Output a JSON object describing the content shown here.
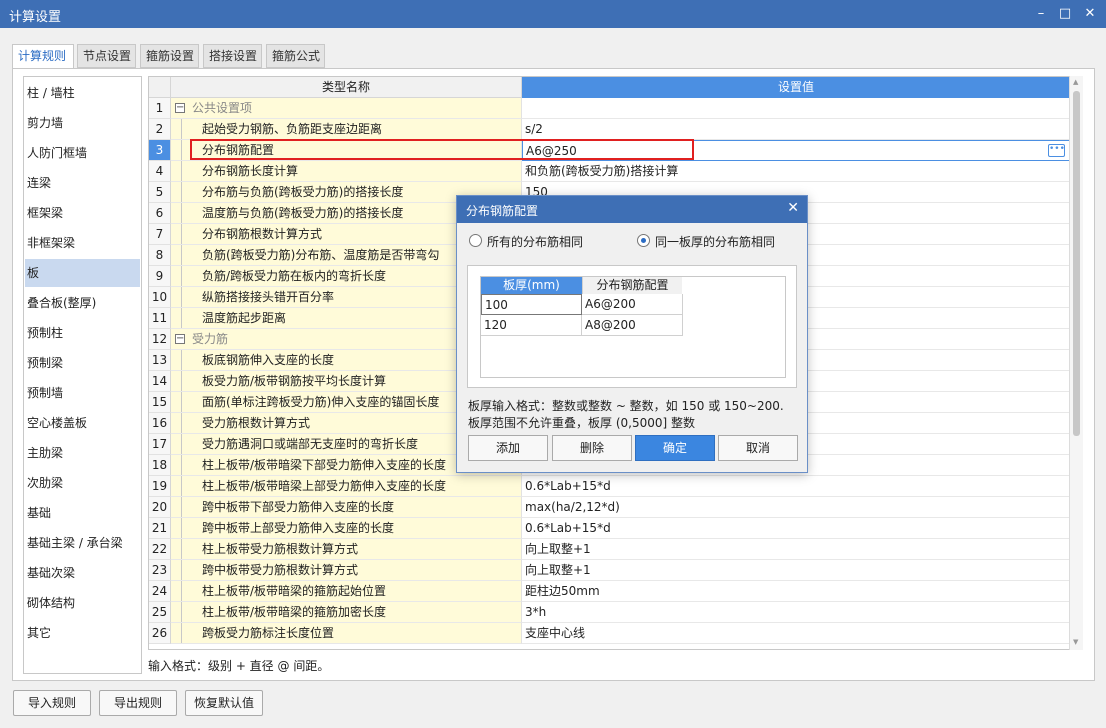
{
  "window": {
    "title": "计算设置",
    "min": "–",
    "max": "□",
    "close": "✕"
  },
  "tabs": [
    "计算规则",
    "节点设置",
    "箍筋设置",
    "搭接设置",
    "箍筋公式"
  ],
  "sidebar": [
    "柱 / 墙柱",
    "剪力墙",
    "人防门框墙",
    "连梁",
    "框架梁",
    "非框架梁",
    "板",
    "叠合板(整厚)",
    "预制柱",
    "预制梁",
    "预制墙",
    "空心楼盖板",
    "主肋梁",
    "次肋梁",
    "基础",
    "基础主梁 / 承台梁",
    "基础次梁",
    "砌体结构",
    "其它"
  ],
  "grid": {
    "headers": {
      "name": "类型名称",
      "value": "设置值"
    },
    "rows": [
      {
        "num": "1",
        "name": "公共设置项",
        "value": ""
      },
      {
        "num": "2",
        "name": "起始受力钢筋、负筋距支座边距离",
        "value": "s/2"
      },
      {
        "num": "3",
        "name": "分布钢筋配置",
        "value": "A6@250"
      },
      {
        "num": "4",
        "name": "分布钢筋长度计算",
        "value": "和负筋(跨板受力筋)搭接计算"
      },
      {
        "num": "5",
        "name": "分布筋与负筋(跨板受力筋)的搭接长度",
        "value": "150"
      },
      {
        "num": "6",
        "name": "温度筋与负筋(跨板受力筋)的搭接长度",
        "value": ""
      },
      {
        "num": "7",
        "name": "分布钢筋根数计算方式",
        "value": ""
      },
      {
        "num": "8",
        "name": "负筋(跨板受力筋)分布筋、温度筋是否带弯勾",
        "value": ""
      },
      {
        "num": "9",
        "name": "负筋/跨板受力筋在板内的弯折长度",
        "value": ""
      },
      {
        "num": "10",
        "name": "纵筋搭接接头错开百分率",
        "value": ""
      },
      {
        "num": "11",
        "name": "温度筋起步距离",
        "value": ""
      },
      {
        "num": "12",
        "name": "受力筋",
        "value": ""
      },
      {
        "num": "13",
        "name": "板底钢筋伸入支座的长度",
        "value": ""
      },
      {
        "num": "14",
        "name": "板受力筋/板带钢筋按平均长度计算",
        "value": ""
      },
      {
        "num": "15",
        "name": "面筋(单标注跨板受力筋)伸入支座的锚固长度",
        "value": ""
      },
      {
        "num": "16",
        "name": "受力筋根数计算方式",
        "value": ""
      },
      {
        "num": "17",
        "name": "受力筋遇洞口或端部无支座时的弯折长度",
        "value": ""
      },
      {
        "num": "18",
        "name": "柱上板带/板带暗梁下部受力筋伸入支座的长度",
        "value": ""
      },
      {
        "num": "19",
        "name": "柱上板带/板带暗梁上部受力筋伸入支座的长度",
        "value": "0.6*Lab+15*d"
      },
      {
        "num": "20",
        "name": "跨中板带下部受力筋伸入支座的长度",
        "value": "max(ha/2,12*d)"
      },
      {
        "num": "21",
        "name": "跨中板带上部受力筋伸入支座的长度",
        "value": "0.6*Lab+15*d"
      },
      {
        "num": "22",
        "name": "柱上板带受力筋根数计算方式",
        "value": "向上取整+1"
      },
      {
        "num": "23",
        "name": "跨中板带受力筋根数计算方式",
        "value": "向上取整+1"
      },
      {
        "num": "24",
        "name": "柱上板带/板带暗梁的箍筋起始位置",
        "value": "距柱边50mm"
      },
      {
        "num": "25",
        "name": "柱上板带/板带暗梁的箍筋加密长度",
        "value": "3*h"
      },
      {
        "num": "26",
        "name": "跨板受力筋标注长度位置",
        "value": "支座中心线"
      }
    ]
  },
  "hint": "输入格式：级别 + 直径 @ 间距。",
  "bottom_buttons": [
    "导入规则",
    "导出规则",
    "恢复默认值"
  ],
  "dialog": {
    "title": "分布钢筋配置",
    "close": "✕",
    "radio_all": "所有的分布筋相同",
    "radio_same": "同一板厚的分布筋相同",
    "table_headers": [
      "板厚(mm)",
      "分布钢筋配置"
    ],
    "table_rows": [
      [
        "100",
        "A6@200"
      ],
      [
        "120",
        "A8@200"
      ]
    ],
    "note1": "板厚输入格式：整数或整数 ~ 整数，如 150 或 150~200.",
    "note2": "板厚范围不允许重叠，板厚 (0,5000] 整数",
    "buttons": [
      "添加",
      "删除",
      "确定",
      "取消"
    ]
  }
}
